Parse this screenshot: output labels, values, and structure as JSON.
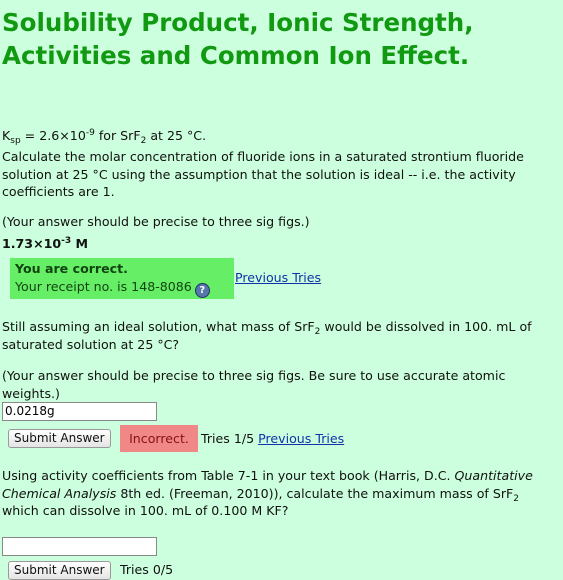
{
  "title": "Solubility Product, Ionic Strength, Activities and Common Ion Effect.",
  "ksp": {
    "base": "K",
    "sub": "sp",
    "eq": " = 2.6×10",
    "exp": "-9",
    "for": " for SrF",
    "for_sub": "2",
    "temp": " at 25 °C."
  },
  "q1": {
    "text": "Calculate the molar concentration of fluoride ions in a saturated strontium fluoride solution at 25 °C using the assumption that the solution is ideal -- i.e. the activity coefficients are 1.",
    "precision": "(Your answer should be precise to three sig figs.)",
    "answer_base": "1.73×10",
    "answer_exp": "-3",
    "answer_unit": " M",
    "correct_title": "You are correct.",
    "receipt": "Your receipt no. is 148-8086",
    "help_glyph": "?",
    "previous_tries": "Previous Tries"
  },
  "q2": {
    "text_a": "Still assuming an ideal solution, what mass of SrF",
    "text_sub": "2",
    "text_b": " would be dissolved in 100. mL of saturated solution at 25 °C?",
    "precision": "(Your answer should be precise to three sig figs. Be sure to use accurate atomic weights.)",
    "input_value": "0.0218g",
    "submit_label": "Submit Answer",
    "status": "Incorrect.",
    "tries": "Tries 1/5",
    "previous_tries": "Previous Tries"
  },
  "q3": {
    "text_a": "Using activity coefficients from Table 7-1 in your text book (Harris, D.C. ",
    "book": "Quantitative Chemical Analysis",
    "text_b": " 8th ed. (Freeman, 2010)), calculate the maximum mass of SrF",
    "text_sub": "2",
    "text_c": " which can dissolve in 100. mL of 0.100 M KF?",
    "input_value": "",
    "submit_label": "Submit Answer",
    "tries": "Tries 0/5"
  },
  "colors": {
    "background": "#ccffdd",
    "title": "#119911",
    "correct_bg": "#66ee66",
    "incorrect_bg": "#f08888",
    "link": "#1133aa"
  }
}
